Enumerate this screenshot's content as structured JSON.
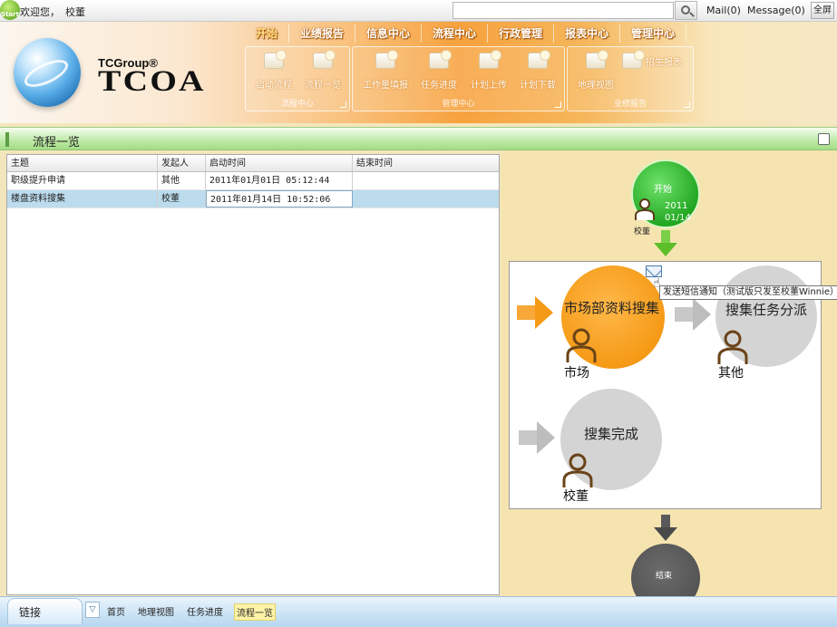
{
  "topbar": {
    "start_badge": "Start",
    "welcome": "欢迎您，",
    "user": "校董",
    "search_placeholder": "",
    "mail": "Mail(0)",
    "message": "Message(0)",
    "fullscreen": "全屏"
  },
  "brand": {
    "group": "TCGroup®",
    "name": "TCOA"
  },
  "nav": {
    "tabs": [
      {
        "label": "开始",
        "active": true
      },
      {
        "label": "业绩报告",
        "active": false
      },
      {
        "label": "信息中心",
        "active": false
      },
      {
        "label": "流程中心",
        "active": false
      },
      {
        "label": "行政管理",
        "active": false
      },
      {
        "label": "报表中心",
        "active": false
      },
      {
        "label": "管理中心",
        "active": false
      }
    ]
  },
  "ribbon": {
    "groups": [
      {
        "label": "流程中心",
        "items": [
          "启动流程",
          "流程一览"
        ]
      },
      {
        "label": "管理中心",
        "items": [
          "工作量填报",
          "任务进度",
          "计划上传",
          "计划下载"
        ]
      },
      {
        "label": "业绩报告",
        "items": [
          "地理视图",
          "招生报表"
        ]
      }
    ]
  },
  "page": {
    "title": "流程一览"
  },
  "grid": {
    "columns": [
      "主题",
      "发起人",
      "启动时间",
      "结束时间"
    ],
    "rows": [
      {
        "subject": "职级提升申请",
        "initiator": "其他",
        "start": "2011年01月01日 05:12:44",
        "end": "",
        "selected": false
      },
      {
        "subject": "楼盘资料搜集",
        "initiator": "校董",
        "start": "2011年01月14日 10:52:06",
        "end": "",
        "selected": true
      }
    ]
  },
  "flow": {
    "start": {
      "label": "开始",
      "date_year": "2011",
      "date_md": "01/14",
      "person": "校董"
    },
    "nodes": [
      {
        "title": "市场部资料搜集",
        "person": "市场",
        "state": "active"
      },
      {
        "title": "搜集任务分派",
        "person": "其他",
        "state": "pending"
      },
      {
        "title": "搜集完成",
        "person": "校董",
        "state": "pending"
      }
    ],
    "tooltip": "发送短信通知（测试版只发至校董Winnie）",
    "end": {
      "label": "结束"
    },
    "colors": {
      "start": "#23a822",
      "active": "#f59a16",
      "pending": "#d4d4d4",
      "end": "#4b4b4b"
    }
  },
  "bottom": {
    "links_label": "链接",
    "toggle": "▽",
    "links": [
      {
        "label": "首页",
        "active": false
      },
      {
        "label": "地理视图",
        "active": false
      },
      {
        "label": "任务进度",
        "active": false
      },
      {
        "label": "流程一览",
        "active": true
      }
    ]
  }
}
